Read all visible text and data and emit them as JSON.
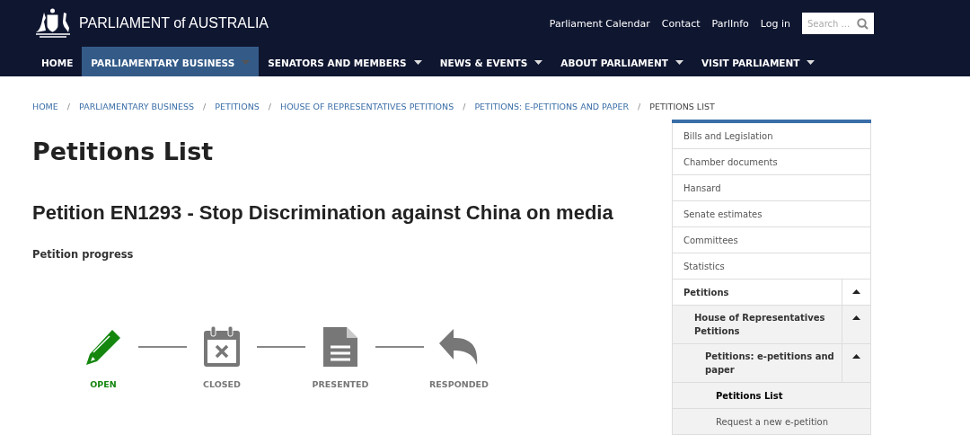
{
  "header": {
    "logo_text": "PARLIAMENT of AUSTRALIA",
    "links": [
      "Parliament Calendar",
      "Contact",
      "ParlInfo",
      "Log in"
    ],
    "search": {
      "placeholder": "Search ..."
    }
  },
  "nav": [
    {
      "label": "HOME",
      "selected": false,
      "dropdown": false
    },
    {
      "label": "PARLIAMENTARY BUSINESS",
      "selected": true,
      "dropdown": true
    },
    {
      "label": "SENATORS AND MEMBERS",
      "selected": false,
      "dropdown": true
    },
    {
      "label": "NEWS & EVENTS",
      "selected": false,
      "dropdown": true
    },
    {
      "label": "ABOUT PARLIAMENT",
      "selected": false,
      "dropdown": true
    },
    {
      "label": "VISIT PARLIAMENT",
      "selected": false,
      "dropdown": true
    }
  ],
  "breadcrumb_separator": "/",
  "breadcrumb": [
    "HOME",
    "PARLIAMENTARY BUSINESS",
    "PETITIONS",
    "HOUSE OF REPRESENTATIVES PETITIONS",
    "PETITIONS: E-PETITIONS AND PAPER",
    "PETITIONS LIST"
  ],
  "page_title": "Petitions List",
  "petition_title": "Petition EN1293 - Stop Discrimination against China on media",
  "progress_label": "Petition progress",
  "steps": [
    {
      "kind": "pencil",
      "label": "OPEN",
      "active": true
    },
    {
      "kind": "calendar",
      "label": "CLOSED",
      "active": false
    },
    {
      "kind": "document",
      "label": "PRESENTED",
      "active": false
    },
    {
      "kind": "reply",
      "label": "RESPONDED",
      "active": false
    }
  ],
  "sidebar": [
    {
      "label": "Bills and Legislation",
      "selected": false
    },
    {
      "label": "Chamber documents",
      "selected": false
    },
    {
      "label": "Hansard",
      "selected": false
    },
    {
      "label": "Senate estimates",
      "selected": false
    },
    {
      "label": "Committees",
      "selected": false
    },
    {
      "label": "Statistics",
      "selected": false
    },
    {
      "label": "Petitions",
      "selected": false,
      "expanded": true,
      "children": [
        {
          "label": "House of Representatives Petitions",
          "selected": false,
          "expanded": true,
          "children": [
            {
              "label": "Petitions: e-petitions and paper",
              "selected": false,
              "expanded": true,
              "children": [
                {
                  "label": "Petitions List",
                  "selected": true
                },
                {
                  "label": "Request a new e-petition",
                  "selected": false
                }
              ]
            }
          ]
        }
      ]
    }
  ]
}
